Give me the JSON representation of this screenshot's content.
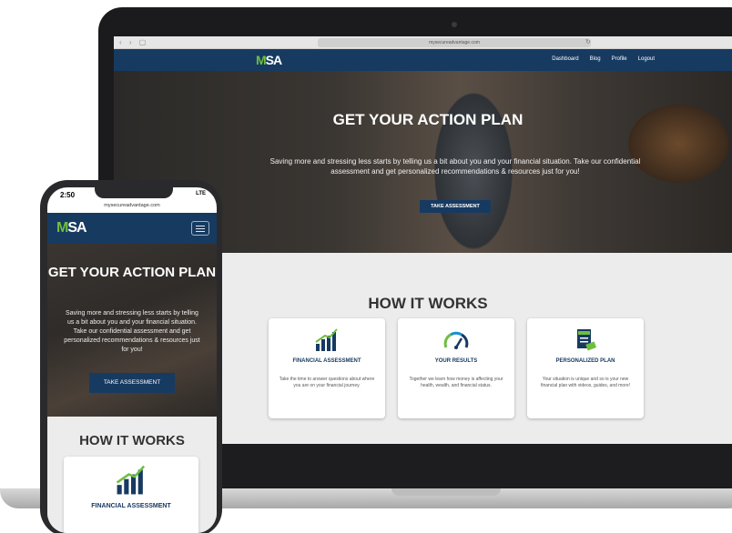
{
  "browser": {
    "url": "mysecureadvantage.com",
    "nav_glyph": "‹ › ▢",
    "refresh_glyph": "↻"
  },
  "brand": {
    "logo_mark": "M",
    "logo_rest": "SA"
  },
  "nav": {
    "links": [
      "Dashboard",
      "Blog",
      "Profile",
      "Logout"
    ]
  },
  "hero": {
    "title": "GET YOUR ACTION PLAN",
    "text": "Saving more and stressing less starts by telling us a bit about you and your financial situation. Take our confidential assessment and get personalized recommendations & resources just for you!",
    "button": "TAKE ASSESSMENT"
  },
  "how_it_works": {
    "title": "HOW IT WORKS",
    "cards": [
      {
        "icon": "bar-chart-icon",
        "title": "FINANCIAL ASSESSMENT",
        "text": "Take the time to answer questions about where you are on your financial journey."
      },
      {
        "icon": "gauge-icon",
        "title": "YOUR RESULTS",
        "text": "Together we learn how money is affecting your health, wealth, and financial status."
      },
      {
        "icon": "plan-document-icon",
        "title": "PERSONALIZED PLAN",
        "text": "Your situation is unique and so is your new financial plan with videos, guides, and more!"
      }
    ]
  },
  "phone": {
    "time": "2:50",
    "status_right": "LTE",
    "url": "mysecureadvantage.com",
    "hero_title": "GET YOUR ACTION PLAN",
    "hero_text": "Saving more and stressing less starts by telling us a bit about you and your financial situation. Take our confidential assessment and get personalized recommendations & resources just for you!",
    "button": "TAKE ASSESSMENT",
    "how_title": "HOW IT WORKS",
    "card_title": "FINANCIAL ASSESSMENT"
  },
  "colors": {
    "navy": "#173a61",
    "green": "#6fbf3f",
    "panel": "#ececec"
  }
}
